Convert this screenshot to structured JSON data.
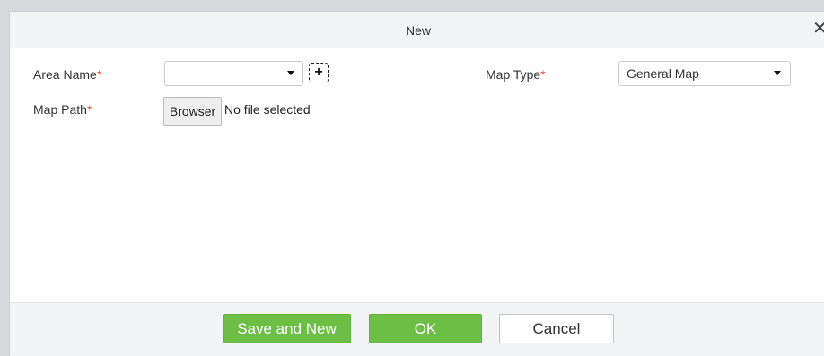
{
  "dialog": {
    "title": "New",
    "close_glyph": "✕"
  },
  "form": {
    "area_name": {
      "label": "Area Name",
      "required_mark": "*",
      "value": ""
    },
    "add_area_glyph": "+",
    "map_type": {
      "label": "Map Type",
      "required_mark": "*",
      "value": "General Map"
    },
    "map_path": {
      "label": "Map Path",
      "required_mark": "*",
      "browse_label": "Browser",
      "file_status": "No file selected"
    }
  },
  "footer": {
    "save_new_label": "Save and New",
    "ok_label": "OK",
    "cancel_label": "Cancel"
  },
  "colors": {
    "accent_green": "#6dbe45",
    "required_red": "#e74c3c",
    "title_bar_bg": "#f3f4f6"
  },
  "icons": {
    "close": "close-icon",
    "dropdown": "chevron-down-icon",
    "add": "plus-icon"
  }
}
